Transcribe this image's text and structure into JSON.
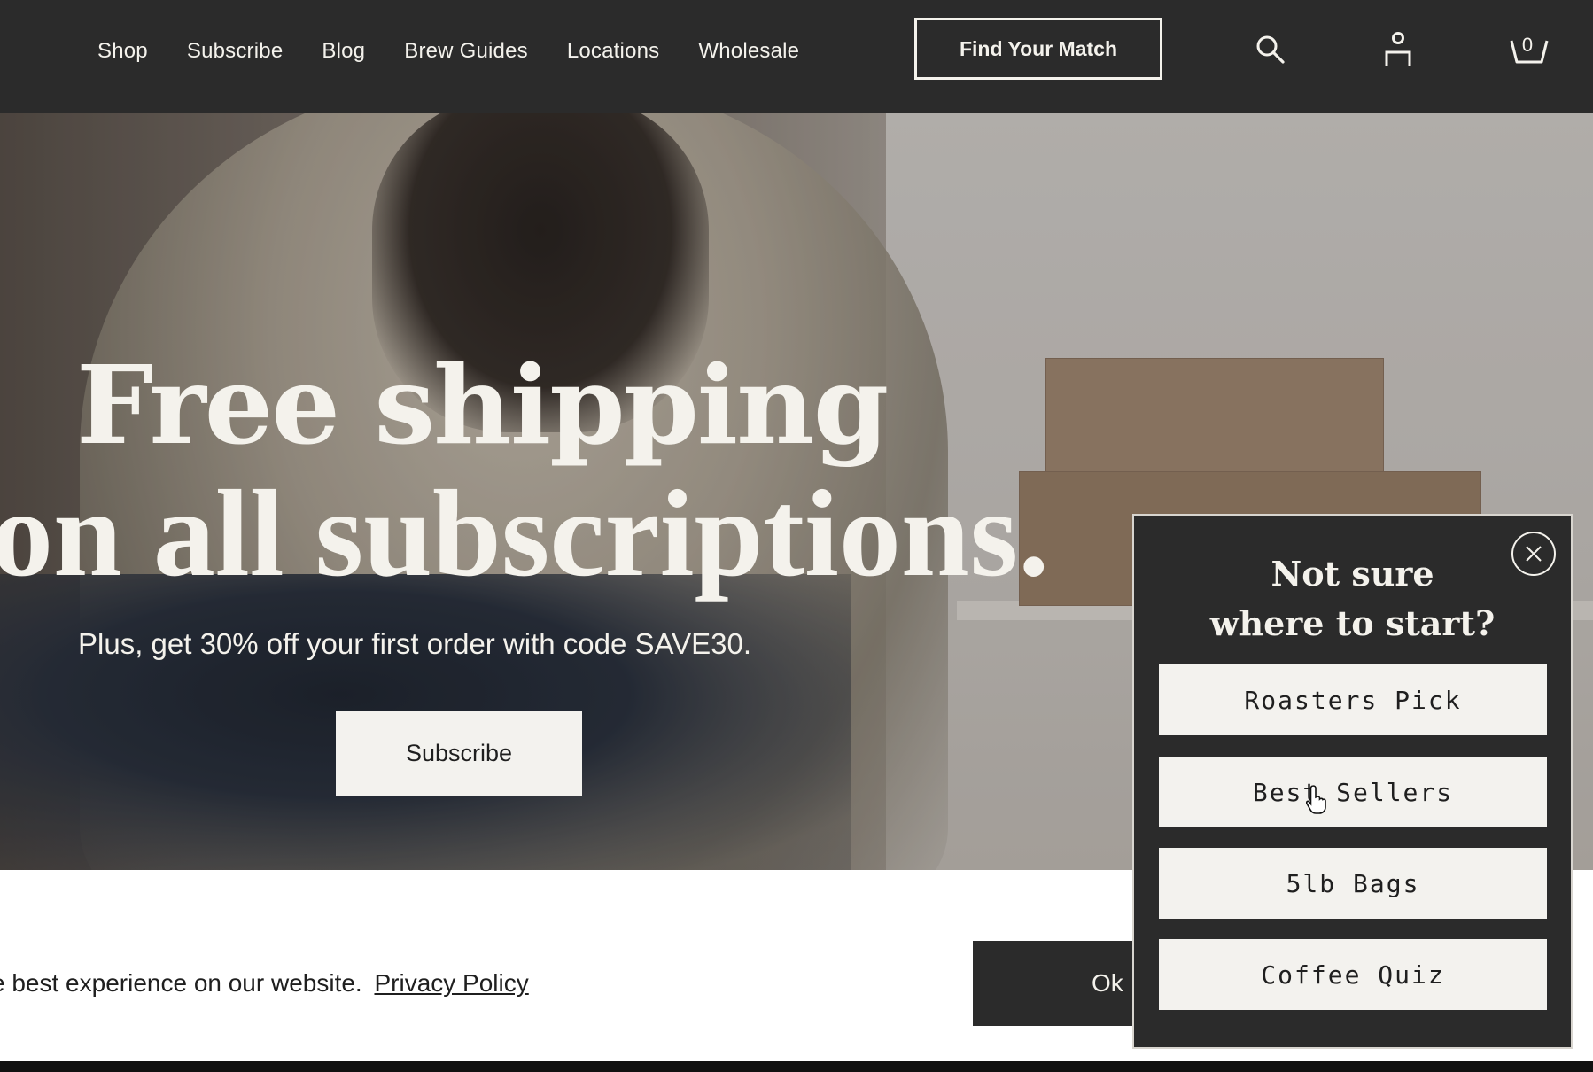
{
  "header": {
    "nav": [
      "Shop",
      "Subscribe",
      "Blog",
      "Brew Guides",
      "Locations",
      "Wholesale"
    ],
    "cta_label": "Find Your Match",
    "cart_count": "0",
    "icons": [
      "search-icon",
      "account-icon",
      "cart-icon"
    ]
  },
  "hero": {
    "title_line1": "Free shipping",
    "title_line2": "on all subscriptions.",
    "subtitle": "Plus, get 30% off your first order with code SAVE30.",
    "button_label": "Subscribe"
  },
  "cookie": {
    "text": "e best experience on our website.",
    "link_label": "Privacy Policy",
    "ok_label": "Ok"
  },
  "popup": {
    "title_line1": "Not sure",
    "title_line2": "where to start?",
    "options": [
      "Roasters Pick",
      "Best Sellers",
      "5lb Bags",
      "Coffee Quiz"
    ]
  },
  "colors": {
    "header_bg": "#2b2b2b",
    "light": "#f4f2ec",
    "button_bg": "#f3f2ee"
  }
}
